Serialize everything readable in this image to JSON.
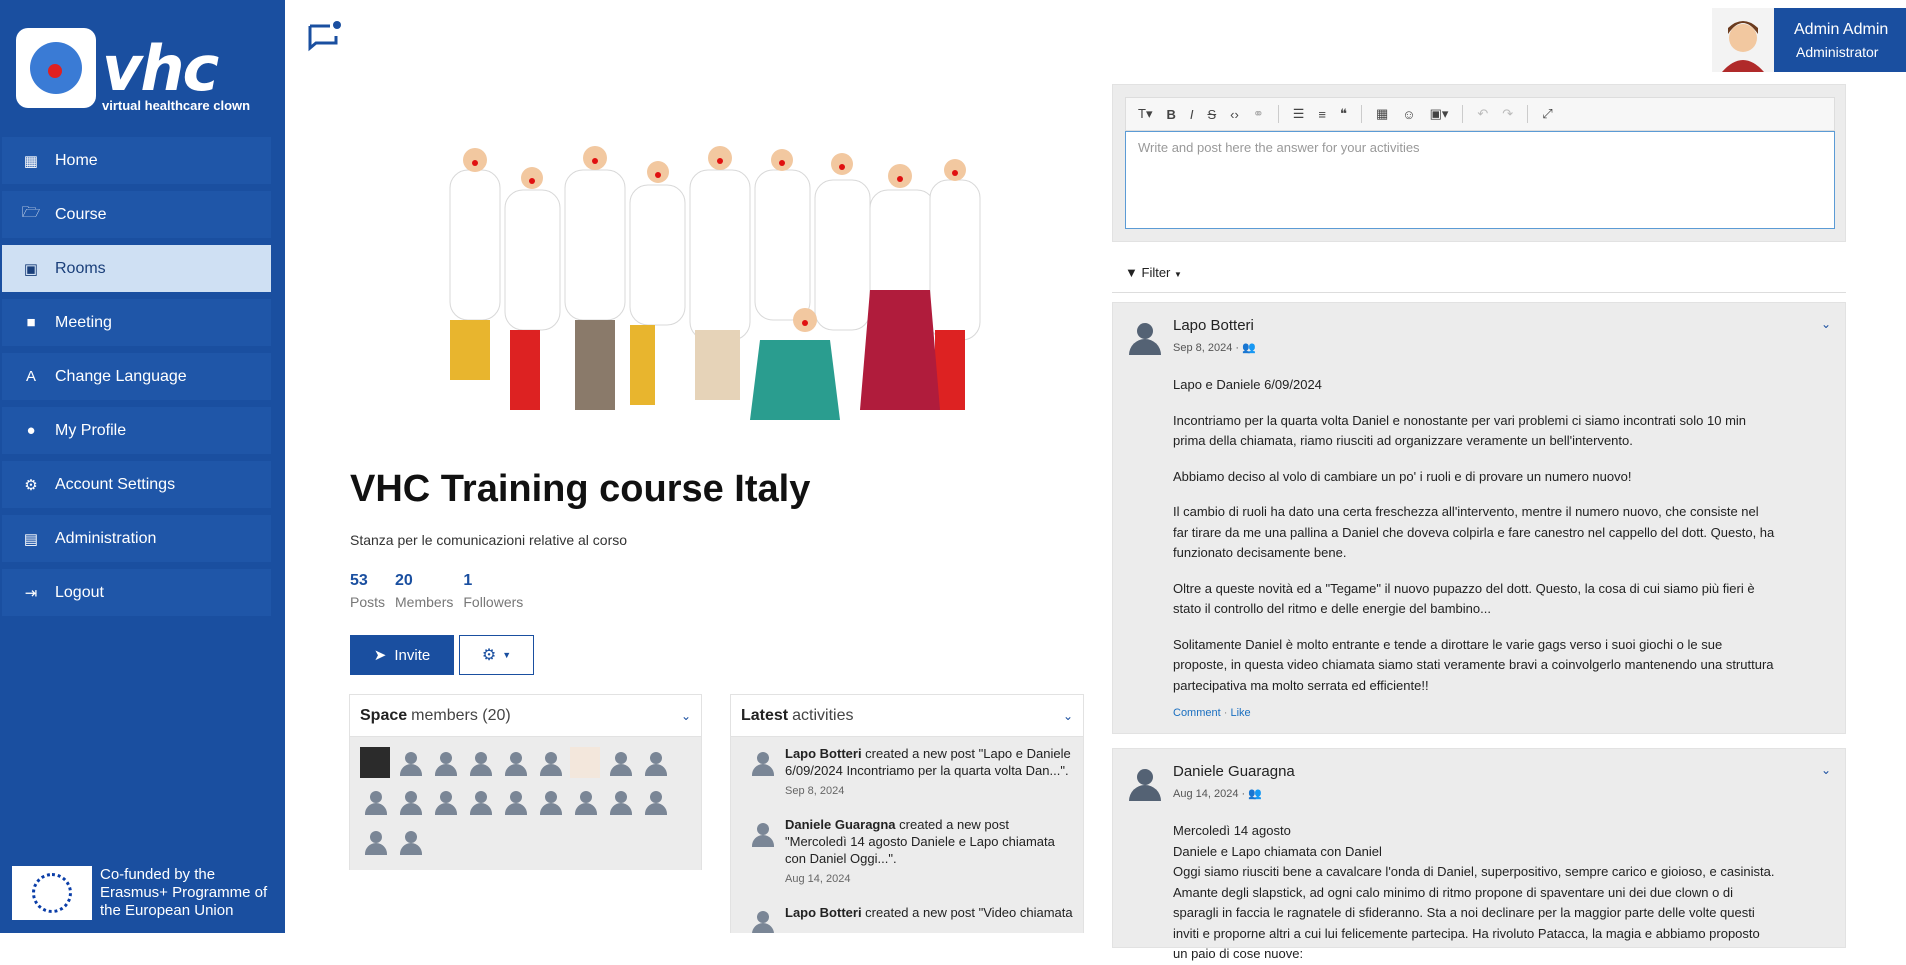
{
  "brand": {
    "logo_text": "vhc",
    "tagline": "virtual healthcare clown"
  },
  "sidebar": {
    "items": [
      {
        "label": "Home",
        "icon": "grid-icon"
      },
      {
        "label": "Course",
        "icon": "folder-open-icon"
      },
      {
        "label": "Rooms",
        "icon": "presentation-icon",
        "active": true
      },
      {
        "label": "Meeting",
        "icon": "video-camera-icon"
      },
      {
        "label": "Change Language",
        "icon": "translate-icon"
      },
      {
        "label": "My Profile",
        "icon": "user-icon"
      },
      {
        "label": "Account Settings",
        "icon": "user-cog-icon"
      },
      {
        "label": "Administration",
        "icon": "admin-panel-icon"
      },
      {
        "label": "Logout",
        "icon": "logout-icon"
      }
    ],
    "footer": "Co-funded by the Erasmus+ Programme of the European Union"
  },
  "user": {
    "name": "Admin Admin",
    "role": "Administrator"
  },
  "space": {
    "title": "VHC Training course Italy",
    "description": "Stanza per le comunicazioni relative al corso",
    "stats": [
      {
        "value": "53",
        "label": "Posts"
      },
      {
        "value": "20",
        "label": "Members"
      },
      {
        "value": "1",
        "label": "Followers"
      }
    ],
    "invite_label": "Invite"
  },
  "members_panel": {
    "title_bold": "Space",
    "title_rest": "members (20)"
  },
  "activities_panel": {
    "title_bold": "Latest",
    "title_rest": "activities",
    "items": [
      {
        "author": "Lapo Botteri",
        "text": " created a new post \"Lapo e Daniele 6/09/2024 Incontriamo per la quarta volta Dan...\".",
        "date": "Sep 8, 2024"
      },
      {
        "author": "Daniele Guaragna",
        "text": " created a new post \"Mercoledì 14 agosto Daniele e Lapo chiamata con Daniel Oggi...\".",
        "date": "Aug 14, 2024"
      },
      {
        "author": "Lapo Botteri",
        "text": " created a new post \"Video chiamata",
        "date": ""
      }
    ]
  },
  "editor": {
    "placeholder": "Write and post here the answer for your activities"
  },
  "filter_label": "Filter",
  "posts": [
    {
      "author": "Lapo Botteri",
      "date": "Sep 8, 2024 ·",
      "paragraphs": [
        "Lapo e Daniele 6/09/2024",
        "Incontriamo per la quarta volta Daniel e nonostante per vari problemi ci siamo incontrati solo 10 min prima della chiamata, riamo riusciti ad organizzare veramente un bell'intervento.",
        "Abbiamo deciso al volo di cambiare un po' i ruoli e di provare un numero nuovo!",
        "Il cambio di ruoli ha dato una certa freschezza all'intervento, mentre il numero nuovo, che consiste nel far tirare da me una pallina a Daniel che doveva colpirla e fare canestro nel cappello del dott. Questo, ha funzionato decisamente bene.",
        "Oltre a queste novità ed a \"Tegame\" il nuovo pupazzo del dott. Questo, la cosa di cui siamo più fieri è stato il controllo del ritmo e delle energie del bambino...",
        "Solitamente Daniel è molto entrante e tende a dirottare le varie gags verso i suoi giochi o le sue proposte, in questa video chiamata siamo stati veramente bravi a coinvolgerlo mantenendo una struttura partecipativa ma molto serrata ed efficiente!!"
      ],
      "comment_label": "Comment",
      "like_label": "Like"
    },
    {
      "author": "Daniele Guaragna",
      "date": "Aug 14, 2024 ·",
      "paragraphs": [
        "Mercoledì 14 agosto",
        "Daniele e Lapo chiamata con Daniel",
        "Oggi siamo riusciti bene a cavalcare l'onda di Daniel, superpositivo, sempre carico e gioioso, e casinista. Amante degli slapstick, ad ogni calo minimo di ritmo propone di spaventare uni dei due clown o di sparagli in faccia le ragnatele di sfideranno. Sta a noi declinare per la maggior parte delle volte questi inviti e proporne altri a cui lui felicemente partecipa. Ha rivoluto Patacca, la magia e abbiamo proposto un paio di cose nuove:"
      ]
    }
  ],
  "colors": {
    "primary": "#1a4fa0",
    "active_bg": "#cfe0f3",
    "panel_bg": "#ececec"
  }
}
